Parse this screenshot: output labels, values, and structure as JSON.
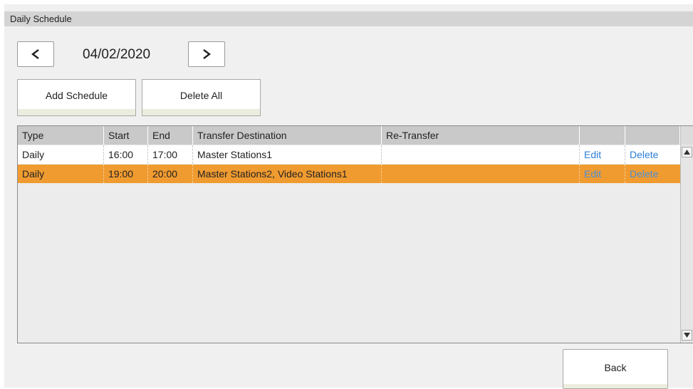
{
  "window": {
    "title": "Daily Schedule"
  },
  "nav": {
    "date": "04/02/2020",
    "prev_icon": "chevron-left-icon",
    "next_icon": "chevron-right-icon"
  },
  "actions": {
    "add_label": "Add Schedule",
    "delete_all_label": "Delete All"
  },
  "table": {
    "headers": [
      "Type",
      "Start",
      "End",
      "Transfer Destination",
      "Re-Transfer",
      "",
      ""
    ],
    "rows": [
      {
        "type": "Daily",
        "start": "16:00",
        "end": "17:00",
        "destination": "Master Stations1",
        "retransfer": "",
        "edit": "Edit",
        "delete": "Delete",
        "selected": false
      },
      {
        "type": "Daily",
        "start": "19:00",
        "end": "20:00",
        "destination": "Master Stations2, Video Stations1",
        "retransfer": "",
        "edit": "Edit",
        "delete": "Delete",
        "selected": true
      }
    ]
  },
  "footer": {
    "back_label": "Back"
  },
  "colors": {
    "selected_row": "#f09b30",
    "link": "#2b7fd8",
    "header_bg": "#c9c9c9"
  }
}
